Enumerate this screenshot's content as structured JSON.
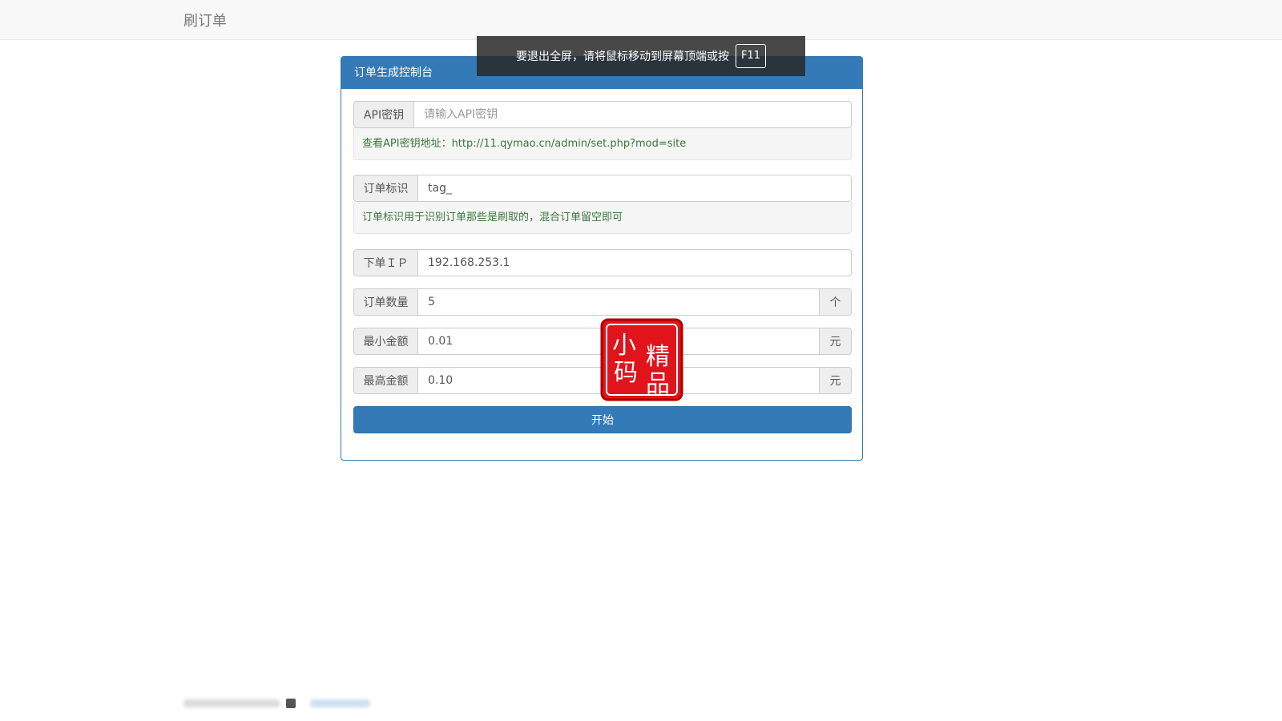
{
  "navbar": {
    "brand": "刷订单"
  },
  "fullscreen_notice": {
    "text": "要退出全屏，请将鼠标移动到屏幕顶端或按",
    "key": "F11"
  },
  "panel": {
    "title": "订单生成控制台",
    "api_key": {
      "label": "API密钥",
      "placeholder": "请输入API密钥",
      "value": ""
    },
    "api_key_help": "查看API密钥地址：http://11.qymao.cn/admin/set.php?mod=site",
    "order_tag": {
      "label": "订单标识",
      "value": "tag_"
    },
    "order_tag_help": "订单标识用于识别订单那些是刷取的，混合订单留空即可",
    "order_ip": {
      "label": "下单ＩＰ",
      "value": "192.168.253.1"
    },
    "order_count": {
      "label": "订单数量",
      "value": "5",
      "unit": "个"
    },
    "min_amount": {
      "label": "最小金额",
      "value": "0.01",
      "unit": "元"
    },
    "max_amount": {
      "label": "最高金额",
      "value": "0.10",
      "unit": "元"
    },
    "start_button": "开始"
  },
  "seal": {
    "chars": [
      "小",
      "精",
      "码",
      "品"
    ],
    "color": "#e0141a"
  },
  "colors": {
    "primary": "#337ab7",
    "help_text": "#3c763d"
  }
}
